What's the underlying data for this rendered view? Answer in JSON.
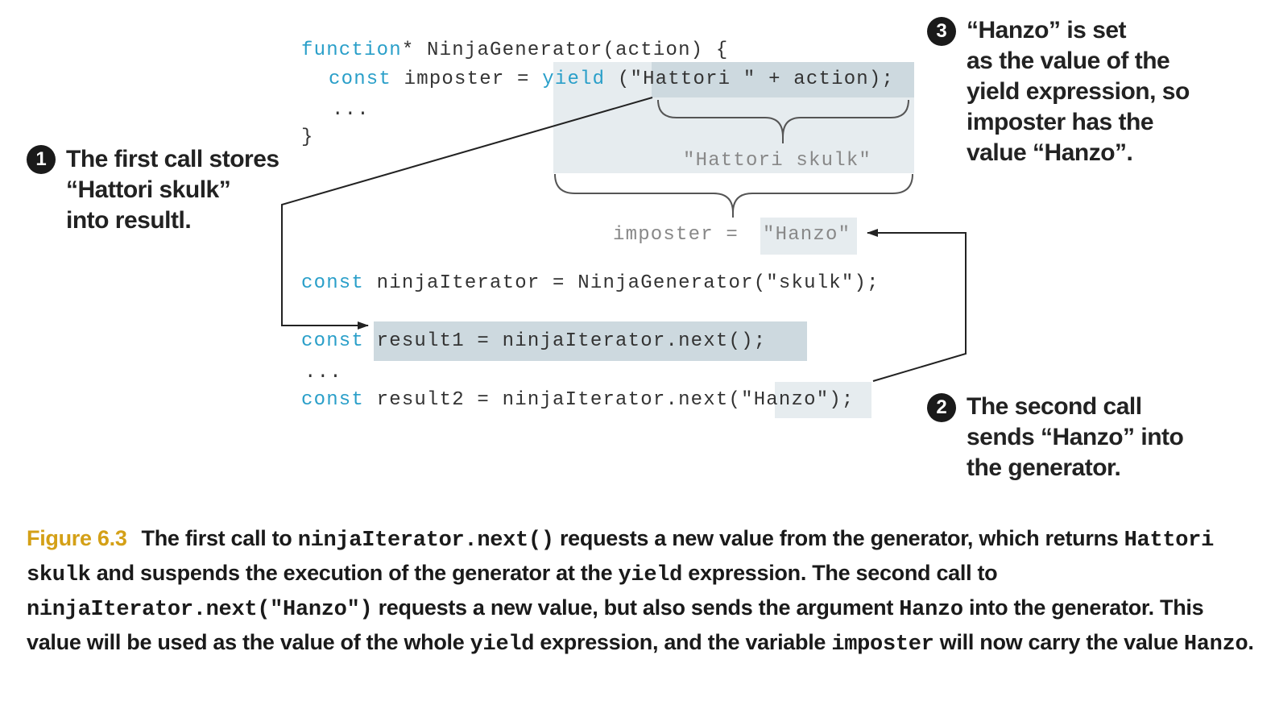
{
  "code": {
    "gen_kw": "function",
    "gen_rest": "* NinjaGenerator(action) {",
    "const_kw": "const",
    "imposter_assign": " imposter = ",
    "yield_kw": "yield",
    "yield_expr": " (\"Hattori \" + action);",
    "ellipsis_inner": "...",
    "close_brace": "}",
    "hattori_skulk": "\"Hattori skulk\"",
    "imposter_label": "imposter = ",
    "hanzo_value": "\"Hanzo\"",
    "iter_line": " ninjaIterator = NinjaGenerator(\"skulk\");",
    "result1_line": " result1 = ninjaIterator.next();",
    "ellipsis_outer": "...",
    "result2_pre": " result2 = ninjaIterator.next(",
    "result2_arg": "\"Hanzo\"",
    "result2_post": ");"
  },
  "annotations": [
    {
      "number": "1",
      "lines": [
        "The first call stores",
        "“Hattori skulk”",
        "into resultl."
      ]
    },
    {
      "number": "2",
      "lines": [
        "The second call",
        "sends “Hanzo” into",
        "the generator."
      ]
    },
    {
      "number": "3",
      "lines": [
        "“Hanzo” is set",
        "as the value of the",
        "yield expression, so",
        "imposter has the",
        "value “Hanzo”."
      ]
    }
  ],
  "caption": {
    "figure_label": "Figure 6.3",
    "t1": "The first call to ",
    "c1": "ninjaIterator.next()",
    "t2": " requests a new value from the generator, which returns ",
    "c2": "Hattori skulk",
    "t3": " and suspends the execution of the generator at the ",
    "c3": "yield",
    "t4": " expression. The second call to ",
    "c4": "ninjaIterator.next(\"Hanzo\")",
    "t5": " requests a new value, but also sends the argument ",
    "c5": "Hanzo",
    "t6": " into the generator. This value will be used as the value of the whole ",
    "c6": "yield",
    "t7": " expression, and the variable ",
    "c7": "imposter",
    "t8": " will now carry the value ",
    "c8": "Hanzo",
    "t9": "."
  },
  "colors": {
    "keyword": "#2a9fc9",
    "figure_label": "#d4a017",
    "highlight_light": "#e6ecef",
    "highlight_dark": "#cdd9df"
  }
}
